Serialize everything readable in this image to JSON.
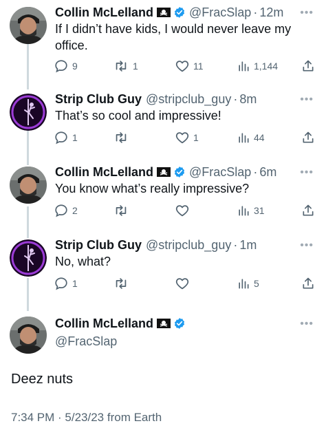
{
  "colors": {
    "text": "#0f1419",
    "secondary": "#536471",
    "verified_blue": "#1d9bf0",
    "thread_line": "#cfd9de",
    "strip_avatar_bg": "#2a0a3a",
    "strip_avatar_ring": "#9b3bd6"
  },
  "tweets": [
    {
      "name": "Collin McLelland",
      "handle": "@FracSlap",
      "dot": "·",
      "time": "12m",
      "text": "If I didn’t have kids, I would never leave my office.",
      "replies": "9",
      "retweets": "1",
      "likes": "11",
      "views": "1,144",
      "avatar_icon": "collin-avatar",
      "badge_icons": [
        "pirate-flag-icon",
        "verified-badge-icon"
      ]
    },
    {
      "name": "Strip Club Guy",
      "handle": "@stripclub_guy",
      "dot": "·",
      "time": "8m",
      "text": "That’s so cool and impressive!",
      "replies": "1",
      "retweets": "",
      "likes": "1",
      "views": "44",
      "avatar_icon": "pole-dancer-avatar"
    },
    {
      "name": "Collin McLelland",
      "handle": "@FracSlap",
      "dot": "·",
      "time": "6m",
      "text": "You know what’s really impressive?",
      "replies": "2",
      "retweets": "",
      "likes": "",
      "views": "31",
      "avatar_icon": "collin-avatar",
      "badge_icons": [
        "pirate-flag-icon",
        "verified-badge-icon"
      ]
    },
    {
      "name": "Strip Club Guy",
      "handle": "@stripclub_guy",
      "dot": "·",
      "time": "1m",
      "text": "No, what?",
      "replies": "1",
      "retweets": "",
      "likes": "",
      "views": "5",
      "avatar_icon": "pole-dancer-avatar"
    }
  ],
  "main_tweet": {
    "name": "Collin McLelland",
    "handle": "@FracSlap",
    "text": "Deez nuts",
    "meta": "7:34 PM · 5/23/23 from Earth"
  }
}
